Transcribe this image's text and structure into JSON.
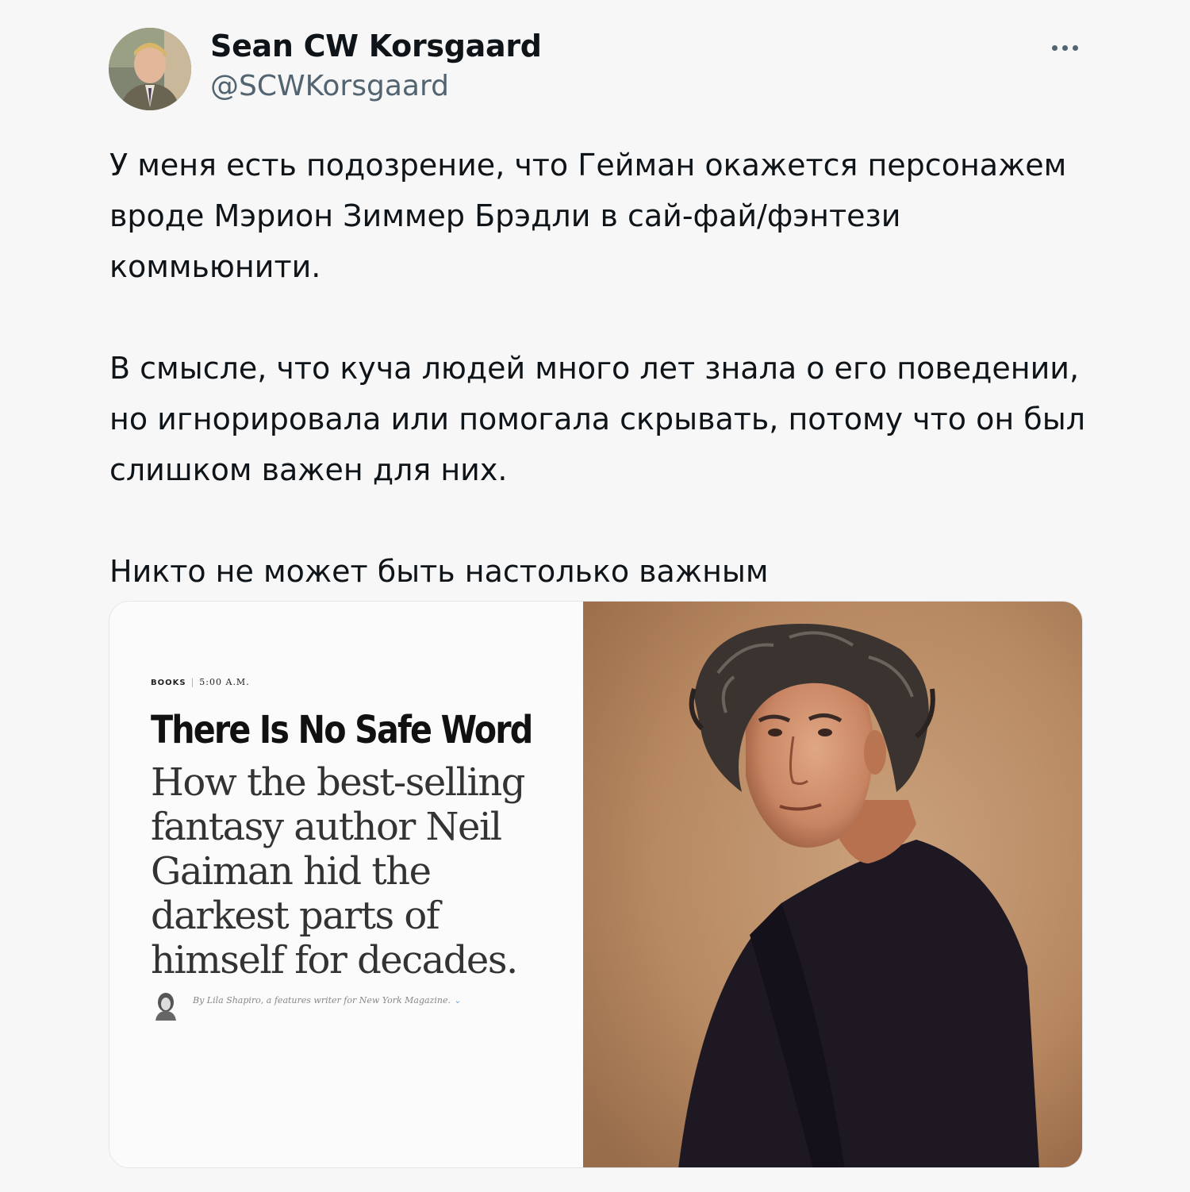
{
  "author": {
    "display_name": "Sean CW Korsgaard",
    "handle": "@SCWKorsgaard"
  },
  "more_icon": "more-horizontal-icon",
  "tweet": {
    "paragraphs": [
      "У меня есть подозрение, что Гейман окажется персонажем вроде Мэрион Зиммер Брэдли в сай-фай/фэнтези коммьюнити.",
      "В смысле, что куча людей много лет знала о его поведении, но игнорировала или помогала скрывать, потому что он был слишком важен для них.",
      "Никто не может быть настолько важным"
    ]
  },
  "media": {
    "kicker_section": "BOOKS",
    "kicker_time": "5:00 A.M.",
    "headline": "There Is No Safe Word",
    "dek": "How the best-selling fantasy author Neil Gaiman hid the darkest parts of himself for decades.",
    "byline": "By Lila Shapiro, a features writer for New York Magazine.",
    "byline_chevron": "⌄"
  },
  "colors": {
    "background": "#f7f7f7",
    "text": "#0f1419",
    "secondary": "#536471",
    "photo_bg": "#b98a62"
  }
}
